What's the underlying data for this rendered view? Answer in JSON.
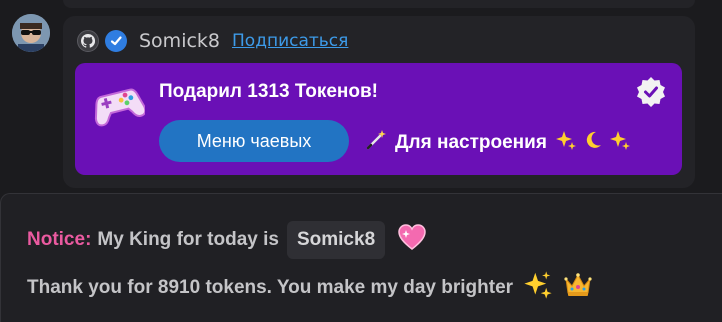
{
  "message": {
    "username": "Somick8",
    "subscribe_label": "Подписаться",
    "badges": [
      "github-icon",
      "verified-check-icon"
    ],
    "avatar": "avatar"
  },
  "tip": {
    "title": "Подарил 1313 Токенов!",
    "menu_button_label": "Меню чаевых",
    "mood_text": "Для настроения",
    "icon": "gamepad-icon",
    "verified_icon": "verified-badge-icon",
    "colors": {
      "card": "#6a10b6",
      "button": "#2274c3"
    }
  },
  "notice": {
    "label": "Notice:",
    "king_text": "My King for today is",
    "king_name": "Somick8",
    "thanks_text": "Thank you for 8910 tokens. You make my day brighter",
    "colors": {
      "label": "#ea5aa0"
    }
  }
}
